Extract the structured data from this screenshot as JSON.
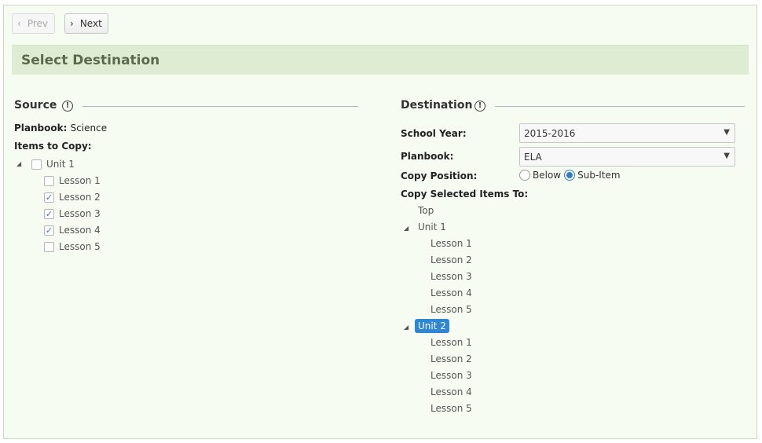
{
  "nav": {
    "prev_label": "Prev",
    "next_label": "Next"
  },
  "banner": {
    "title": "Select Destination"
  },
  "source": {
    "title": "Source",
    "info_icon": "!",
    "planbook_label": "Planbook:",
    "planbook_value": "Science",
    "items_label": "Items to Copy:",
    "tree": [
      {
        "label": "Unit 1",
        "checked": false,
        "expanded": true
      },
      {
        "label": "Lesson 1",
        "checked": false
      },
      {
        "label": "Lesson 2",
        "checked": true
      },
      {
        "label": "Lesson 3",
        "checked": true
      },
      {
        "label": "Lesson 4",
        "checked": true
      },
      {
        "label": "Lesson 5",
        "checked": false
      }
    ]
  },
  "destination": {
    "title": "Destination",
    "info_icon": "!",
    "school_year_label": "School Year:",
    "school_year_value": "2015-2016",
    "planbook_label": "Planbook:",
    "planbook_value": "ELA",
    "copy_position_label": "Copy Position:",
    "position_options": [
      "Below",
      "Sub-Item"
    ],
    "position_selected": "Sub-Item",
    "copy_to_label": "Copy Selected Items To:",
    "tree": {
      "top": "Top",
      "units": [
        {
          "label": "Unit 1",
          "selected": false,
          "lessons": [
            "Lesson 1",
            "Lesson 2",
            "Lesson 3",
            "Lesson 4",
            "Lesson 5"
          ]
        },
        {
          "label": "Unit 2",
          "selected": true,
          "lessons": [
            "Lesson 1",
            "Lesson 2",
            "Lesson 3",
            "Lesson 4",
            "Lesson 5"
          ]
        }
      ]
    }
  },
  "icons": {
    "chevron_left": "chevron-left-icon",
    "chevron_right": "chevron-right-icon",
    "expand_arrow": "expand-arrow-icon",
    "dropdown": "dropdown-arrow-icon",
    "checkmark": "checkmark-icon"
  },
  "colors": {
    "accent": "#2f86d4",
    "banner_bg": "#dfecd4",
    "banner_text": "#5b6b4a"
  }
}
